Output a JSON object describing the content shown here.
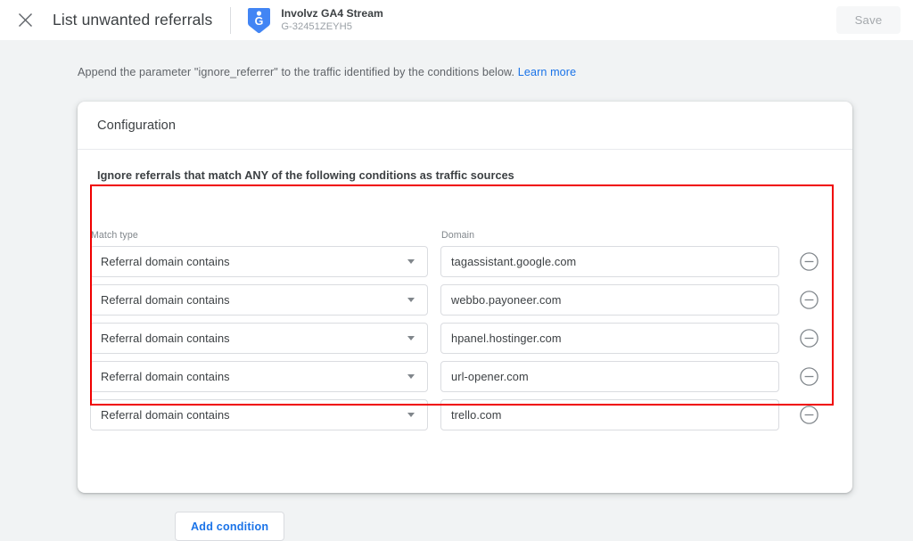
{
  "appbar": {
    "close_icon": "close-icon",
    "title": "List unwanted referrals",
    "stream": {
      "icon": "google-analytics-tag-icon",
      "name": "Involvz GA4 Stream",
      "id": "G-32451ZEYH5"
    },
    "save_label": "Save",
    "save_disabled": true
  },
  "intro": {
    "text": "Append the parameter \"ignore_referrer\" to the traffic identified by the conditions below.",
    "link_label": "Learn more",
    "link_color": "#1a73e8"
  },
  "card": {
    "header_title": "Configuration",
    "section_heading": "Ignore referrals that match ANY of the following conditions as traffic sources",
    "labels": {
      "match_type": "Match type",
      "domain": "Domain"
    },
    "conditions": [
      {
        "match_type": "Referral domain contains",
        "domain": "tagassistant.google.com",
        "remove_icon": "remove-circle-icon"
      },
      {
        "match_type": "Referral domain contains",
        "domain": "webbo.payoneer.com",
        "remove_icon": "remove-circle-icon"
      },
      {
        "match_type": "Referral domain contains",
        "domain": "hpanel.hostinger.com",
        "remove_icon": "remove-circle-icon"
      },
      {
        "match_type": "Referral domain contains",
        "domain": "url-opener.com",
        "remove_icon": "remove-circle-icon"
      },
      {
        "match_type": "Referral domain contains",
        "domain": "trello.com",
        "remove_icon": "remove-circle-icon"
      }
    ],
    "add_condition_label": "Add condition"
  },
  "annotation": {
    "highlight_color": "#f00000"
  }
}
